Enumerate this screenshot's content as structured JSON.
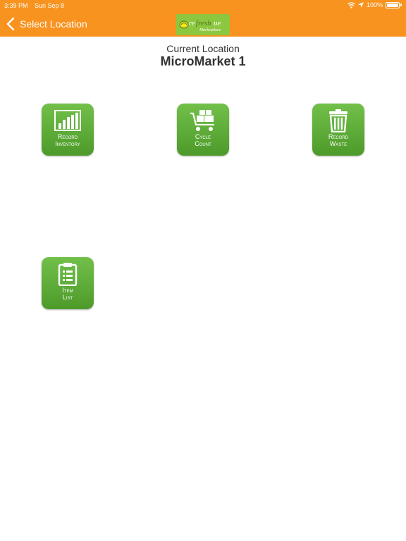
{
  "status_bar": {
    "time": "3:39 PM",
    "date": "Sun Sep 8",
    "battery": "100%"
  },
  "nav": {
    "back_label": "Select Location",
    "logo_text_a": "refresh",
    "logo_text_b": "Marketplace"
  },
  "header": {
    "label": "Current Location",
    "title": "MicroMarket 1"
  },
  "tiles": [
    {
      "line1": "Record",
      "line2": "Inventory",
      "icon": "bar-chart-icon"
    },
    {
      "line1": "Cycle",
      "line2": "Count",
      "icon": "cart-icon"
    },
    {
      "line1": "Record",
      "line2": "Waste",
      "icon": "trash-icon"
    },
    {
      "line1": "Item",
      "line2": "List",
      "icon": "clipboard-icon"
    }
  ],
  "colors": {
    "nav_orange": "#f7931e",
    "tile_green": "#5aab34",
    "logo_green": "#8dc63f"
  }
}
